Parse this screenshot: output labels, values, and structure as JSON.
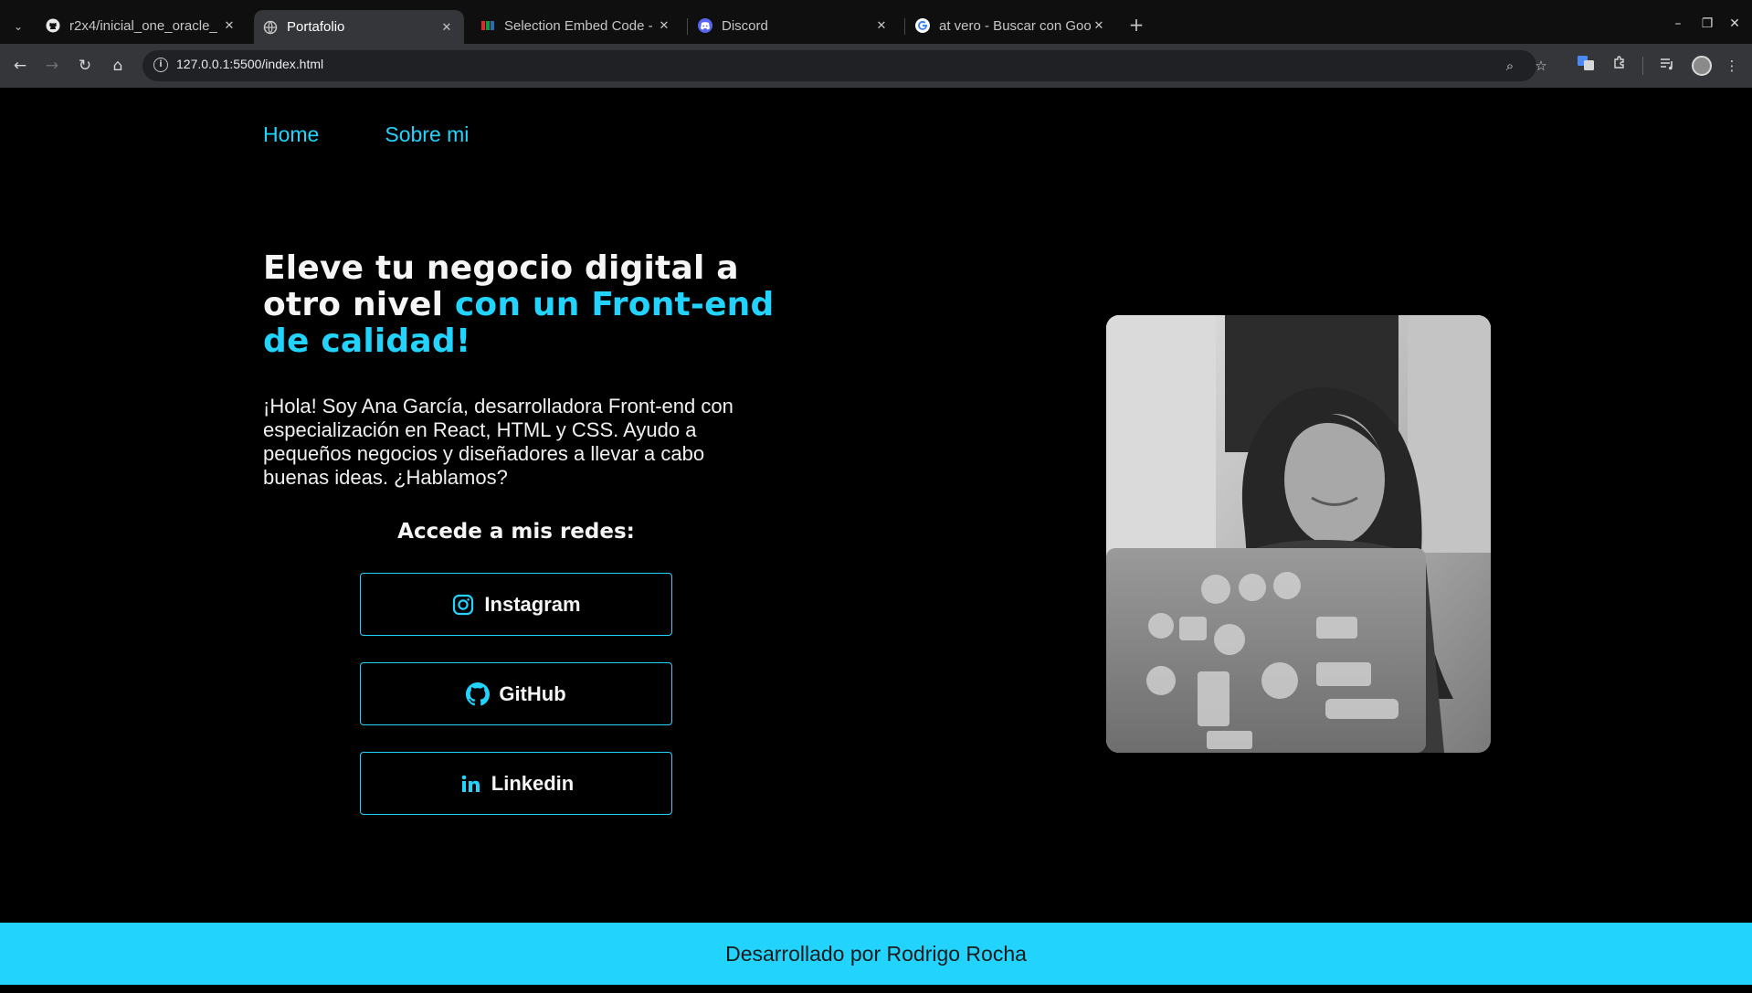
{
  "browser": {
    "tabs": [
      {
        "title": "r2x4/inicial_one_oracle_",
        "favicon": "github-icon",
        "active": false
      },
      {
        "title": "Portafolio",
        "favicon": "globe-icon",
        "active": true
      },
      {
        "title": "Selection Embed Code - ",
        "favicon": "zoho-icon",
        "active": false
      },
      {
        "title": "Discord",
        "favicon": "discord-icon",
        "active": false
      },
      {
        "title": "at vero - Buscar con Goo",
        "favicon": "google-icon",
        "active": false
      }
    ],
    "url": "127.0.0.1:5500/index.html"
  },
  "nav": {
    "items": [
      "Home",
      "Sobre mi"
    ]
  },
  "hero": {
    "title_plain": "Eleve tu negocio digital a otro nivel ",
    "title_accent": "con un Front-end de calidad!",
    "text": "¡Hola! Soy Ana García, desarrolladora Front-end con especialización en React, HTML y CSS. Ayudo a pequeños negocios y diseñadores a llevar a cabo buenas ideas. ¿Hablamos?"
  },
  "social": {
    "title": "Accede a mis redes:",
    "buttons": [
      {
        "label": "Instagram",
        "icon": "instagram-icon"
      },
      {
        "label": "GitHub",
        "icon": "github-icon"
      },
      {
        "label": "Linkedin",
        "icon": "linkedin-icon"
      }
    ]
  },
  "footer": {
    "text": "Desarrollado por Rodrigo Rocha"
  },
  "colors": {
    "accent": "#22d4fd",
    "background": "#000000"
  }
}
